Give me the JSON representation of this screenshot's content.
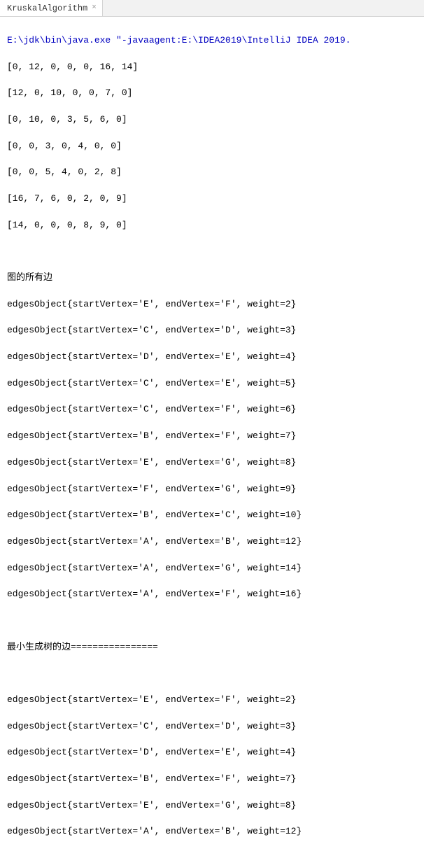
{
  "tab": {
    "label": "KruskalAlgorithm",
    "close": "×"
  },
  "console": {
    "command": "E:\\jdk\\bin\\java.exe \"-javaagent:E:\\IDEA2019\\IntelliJ IDEA 2019.",
    "matrix": [
      "[0, 12, 0, 0, 0, 16, 14]",
      "[12, 0, 10, 0, 0, 7, 0]",
      "[0, 10, 0, 3, 5, 6, 0]",
      "[0, 0, 3, 0, 4, 0, 0]",
      "[0, 0, 5, 4, 0, 2, 8]",
      "[16, 7, 6, 0, 2, 0, 9]",
      "[14, 0, 0, 0, 8, 9, 0]"
    ],
    "allEdgesHeader": "图的所有边",
    "allEdges": [
      "edgesObject{startVertex='E', endVertex='F', weight=2}",
      "edgesObject{startVertex='C', endVertex='D', weight=3}",
      "edgesObject{startVertex='D', endVertex='E', weight=4}",
      "edgesObject{startVertex='C', endVertex='E', weight=5}",
      "edgesObject{startVertex='C', endVertex='F', weight=6}",
      "edgesObject{startVertex='B', endVertex='F', weight=7}",
      "edgesObject{startVertex='E', endVertex='G', weight=8}",
      "edgesObject{startVertex='F', endVertex='G', weight=9}",
      "edgesObject{startVertex='B', endVertex='C', weight=10}",
      "edgesObject{startVertex='A', endVertex='B', weight=12}",
      "edgesObject{startVertex='A', endVertex='G', weight=14}",
      "edgesObject{startVertex='A', endVertex='F', weight=16}"
    ],
    "mstHeader": "最小生成树的边================",
    "mstEdges": [
      "edgesObject{startVertex='E', endVertex='F', weight=2}",
      "edgesObject{startVertex='C', endVertex='D', weight=3}",
      "edgesObject{startVertex='D', endVertex='E', weight=4}",
      "edgesObject{startVertex='B', endVertex='F', weight=7}",
      "edgesObject{startVertex='E', endVertex='G', weight=8}",
      "edgesObject{startVertex='A', endVertex='B', weight=12}"
    ]
  }
}
